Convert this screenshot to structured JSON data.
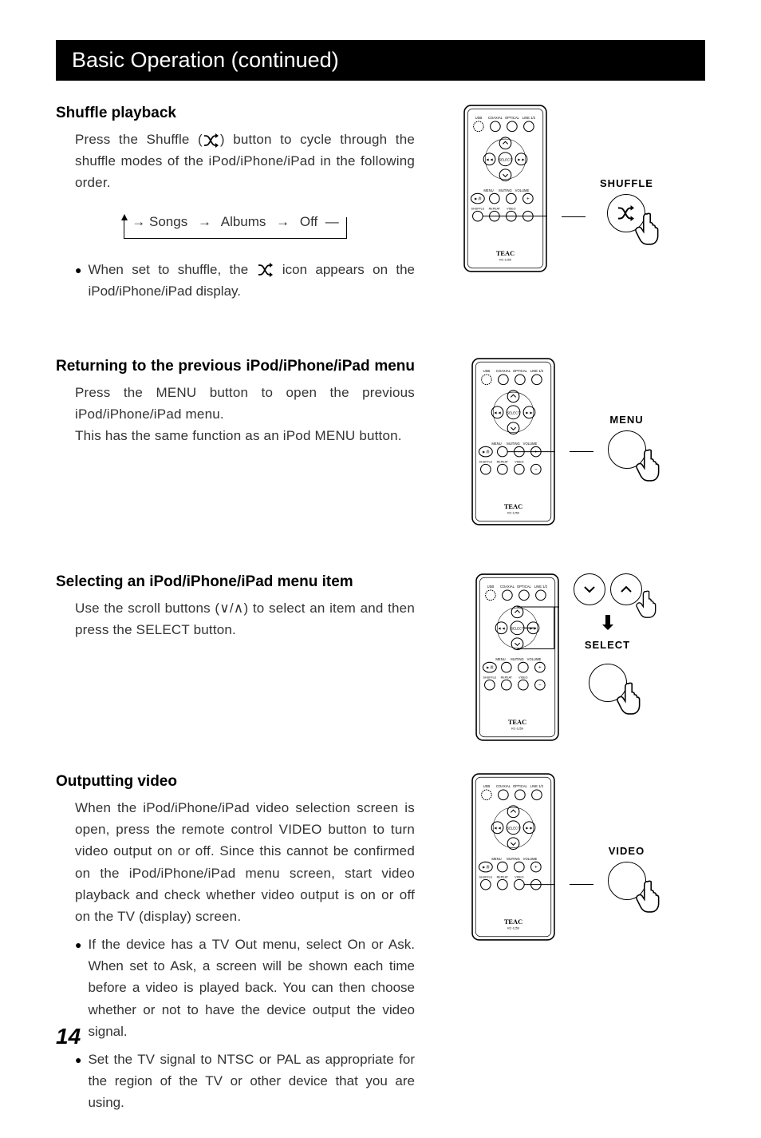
{
  "banner": "Basic Operation (continued)",
  "shuffle": {
    "heading": "Shuffle playback",
    "para1_a": "Press the Shuffle (",
    "para1_b": ") button to cycle through the shuffle modes of the iPod/iPhone/iPad in the following order.",
    "cycle": {
      "a": "Songs",
      "b": "Albums",
      "c": "Off"
    },
    "bullet1_a": "When set to shuffle, the ",
    "bullet1_b": " icon appears on the iPod/iPhone/iPad display.",
    "callout": "SHUFFLE"
  },
  "returning": {
    "heading": "Returning to the previous iPod/iPhone/iPad menu",
    "para1": "Press the MENU button to open the previous iPod/iPhone/iPad menu.",
    "para2": "This has the same function as an iPod MENU button.",
    "callout": "MENU"
  },
  "selecting": {
    "heading": "Selecting an iPod/iPhone/iPad menu item",
    "para1": "Use the scroll buttons (∨/∧) to select an item and then press the SELECT button.",
    "callout": "SELECT"
  },
  "outputting": {
    "heading": "Outputting video",
    "para1": "When the iPod/iPhone/iPad video selection screen is open, press the remote control VIDEO button to turn video output on or off. Since this cannot be confirmed on the iPod/iPhone/iPad menu screen, start video playback and check whether video output is on or off on the TV (display) screen.",
    "bullet1": "If the device has a TV Out menu, select On or Ask. When set to Ask, a screen will be shown each time before a video is played back. You can then choose whether or not to have the device output the video signal.",
    "bullet2": "Set the TV signal to NTSC or PAL as appropriate for the region of the TV or other device that you are using.",
    "callout": "VIDEO"
  },
  "remote": {
    "brand": "TEAC",
    "model": "RC-1259",
    "top_labels": [
      "USB",
      "COAXIAL",
      "OPTICAL",
      "LINE 1/2"
    ],
    "mid_labels": [
      "MENU",
      "MUTING",
      "VOLUME"
    ],
    "bot_labels": [
      "SHUFFLE",
      "REPEAT",
      "VIDEO"
    ],
    "select": "SELECT"
  },
  "page": "14"
}
